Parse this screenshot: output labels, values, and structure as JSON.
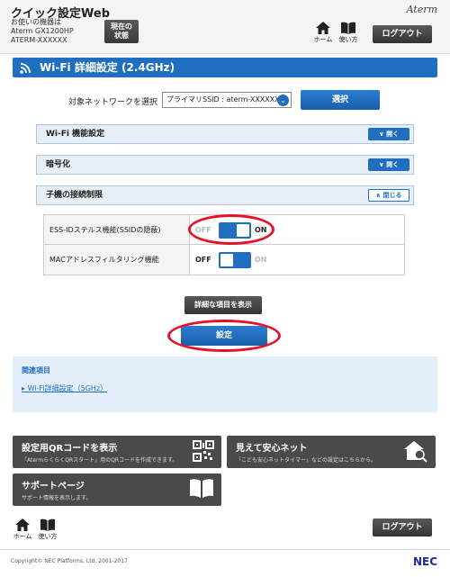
{
  "header": {
    "title": "クイック設定Web",
    "device_label": "お使いの機器は",
    "device_model": "Aterm GX1200HP",
    "device_name": "ATERM-XXXXXX",
    "status_button_line1": "現在の",
    "status_button_line2": "状態",
    "brand": "Aterm",
    "home_label": "ホーム",
    "help_label": "使い方",
    "logout_label": "ログアウト"
  },
  "page": {
    "title": "Wi-Fi 詳細設定 (2.4GHz)"
  },
  "network_select": {
    "label": "対象ネットワークを選択",
    "selected": "プライマリSSID : aterm-XXXXXX-g",
    "button_label": "選択"
  },
  "accordions": [
    {
      "label": "Wi-Fi 機能設定",
      "button": "開く"
    },
    {
      "label": "暗号化",
      "button": "開く"
    },
    {
      "label": "子機の接続制限",
      "button": "閉じる"
    }
  ],
  "settings": [
    {
      "label": "ESS-IDステルス機能(SSIDの隠蔽)",
      "off": "OFF",
      "on": "ON",
      "state": "on"
    },
    {
      "label": "MACアドレスフィルタリング機能",
      "off": "OFF",
      "on": "ON",
      "state": "off"
    }
  ],
  "actions": {
    "details_label": "詳細な項目を表示",
    "apply_label": "設定"
  },
  "related": {
    "title": "関連項目",
    "link": "Wi-Fi詳細設定（5GHz）"
  },
  "tiles": [
    {
      "title": "設定用QRコードを表示",
      "desc": "「AtermらくらくQRスタート」用のQRコードを作成できます。",
      "icon": "qr-code-icon"
    },
    {
      "title": "見えて安心ネット",
      "desc": "「こども安心ネットタイマー」などの設定はこちらから。",
      "icon": "home-search-icon"
    },
    {
      "title": "サポートページ",
      "desc": "サポート情報を表示します。",
      "icon": "book-icon"
    }
  ],
  "footer": {
    "home_label": "ホーム",
    "help_label": "使い方",
    "logout_label": "ログアウト",
    "copyright": "Copyright© NEC Platforms, Ltd. 2001-2017",
    "brand": "NEC"
  },
  "colors": {
    "accent": "#1f6ec0",
    "highlight_ring": "#e8112a",
    "tile_bg": "#4a4a4a"
  }
}
